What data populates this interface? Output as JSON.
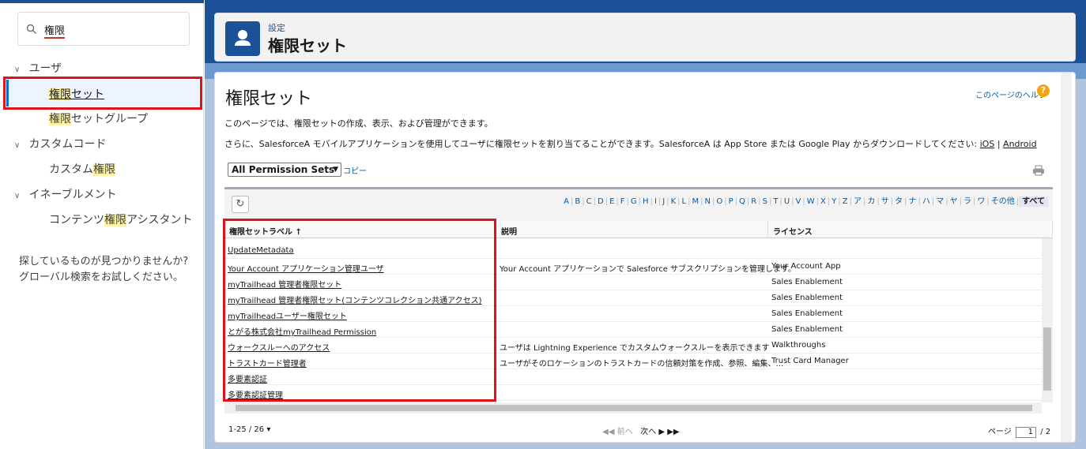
{
  "sidebar": {
    "search_value": "権限",
    "items": [
      {
        "label": "ユーザ"
      },
      {
        "label_before": "",
        "label_hl": "権限",
        "label_after": "セット"
      },
      {
        "label_before": "",
        "label_hl": "権限",
        "label_after": "セットグループ"
      },
      {
        "label": "カスタムコード"
      },
      {
        "label_before": "カスタム",
        "label_hl": "権限",
        "label_after": ""
      },
      {
        "label": "イネーブルメント"
      },
      {
        "label_before": "コンテンツ",
        "label_hl": "権限",
        "label_after": "アシスタント"
      }
    ],
    "not_found_line1": "探しているものが見つかりませんか?",
    "not_found_line2": "グローバル検索をお試しください。"
  },
  "header": {
    "breadcrumb": "設定",
    "title": "権限セット"
  },
  "main": {
    "title": "権限セット",
    "help_link": "このページのヘルプ",
    "help_icon": "?",
    "description1": "このページでは、権限セットの作成、表示、および管理ができます。",
    "description2": "さらに、SalesforceA モバイルアプリケーションを使用してユーザに権限セットを割り当てることができます。SalesforceA は App Store または Google Play からダウンロードしてください:",
    "ios_link": "iOS",
    "link_separator": "|",
    "android_link": "Android",
    "view_select": "All Permission Sets",
    "copy_link": "コピー",
    "alphabet": [
      "A",
      "B",
      "C",
      "D",
      "E",
      "F",
      "G",
      "H",
      "I",
      "J",
      "K",
      "L",
      "M",
      "N",
      "O",
      "P",
      "Q",
      "R",
      "S",
      "T",
      "U",
      "V",
      "W",
      "X",
      "Y",
      "Z",
      "ア",
      "カ",
      "サ",
      "タ",
      "ナ",
      "ハ",
      "マ",
      "ヤ",
      "ラ",
      "ワ",
      "その他"
    ],
    "alphabet_all": "すべて",
    "columns": [
      "権限セットラベル ↑",
      "説明",
      "ライセンス"
    ],
    "rows": [
      {
        "label": "UpdateMetadata",
        "description": "",
        "license": ""
      },
      {
        "label": "Your Account アプリケーション管理ユーザ",
        "description": "Your Account アプリケーションで Salesforce サブスクリプションを管理します。",
        "license": "Your Account App"
      },
      {
        "label": "myTrailhead 管理者権限セット",
        "description": "",
        "license": "Sales Enablement"
      },
      {
        "label": "myTrailhead 管理者権限セット(コンテンツコレクション共通アクセス)",
        "description": "",
        "license": "Sales Enablement"
      },
      {
        "label": "myTrailheadユーザー権限セット",
        "description": "",
        "license": "Sales Enablement"
      },
      {
        "label": "とがる株式会社myTrailhead Permission",
        "description": "",
        "license": "Sales Enablement"
      },
      {
        "label": "ウォークスルーへのアクセス",
        "description": "ユーザは Lightning Experience でカスタムウォークスルーを表示できます",
        "license": "Walkthroughs"
      },
      {
        "label": "トラストカード管理者",
        "description": "ユーザがそのロケーションのトラストカードの信頼対策を作成、参照、編集、…",
        "license": "Trust Card Manager"
      },
      {
        "label": "多要素認証",
        "description": "",
        "license": ""
      },
      {
        "label": "多要素認証管理",
        "description": "",
        "license": ""
      }
    ],
    "pager": {
      "count": "1-25 / 26",
      "prev": "前へ",
      "next": "次へ",
      "page_label": "ページ",
      "page_value": "1",
      "page_total": "/ 2"
    }
  },
  "colors": {
    "accent": "#1b5297",
    "highlight_box": "#e0121a",
    "link": "#015ba7"
  }
}
